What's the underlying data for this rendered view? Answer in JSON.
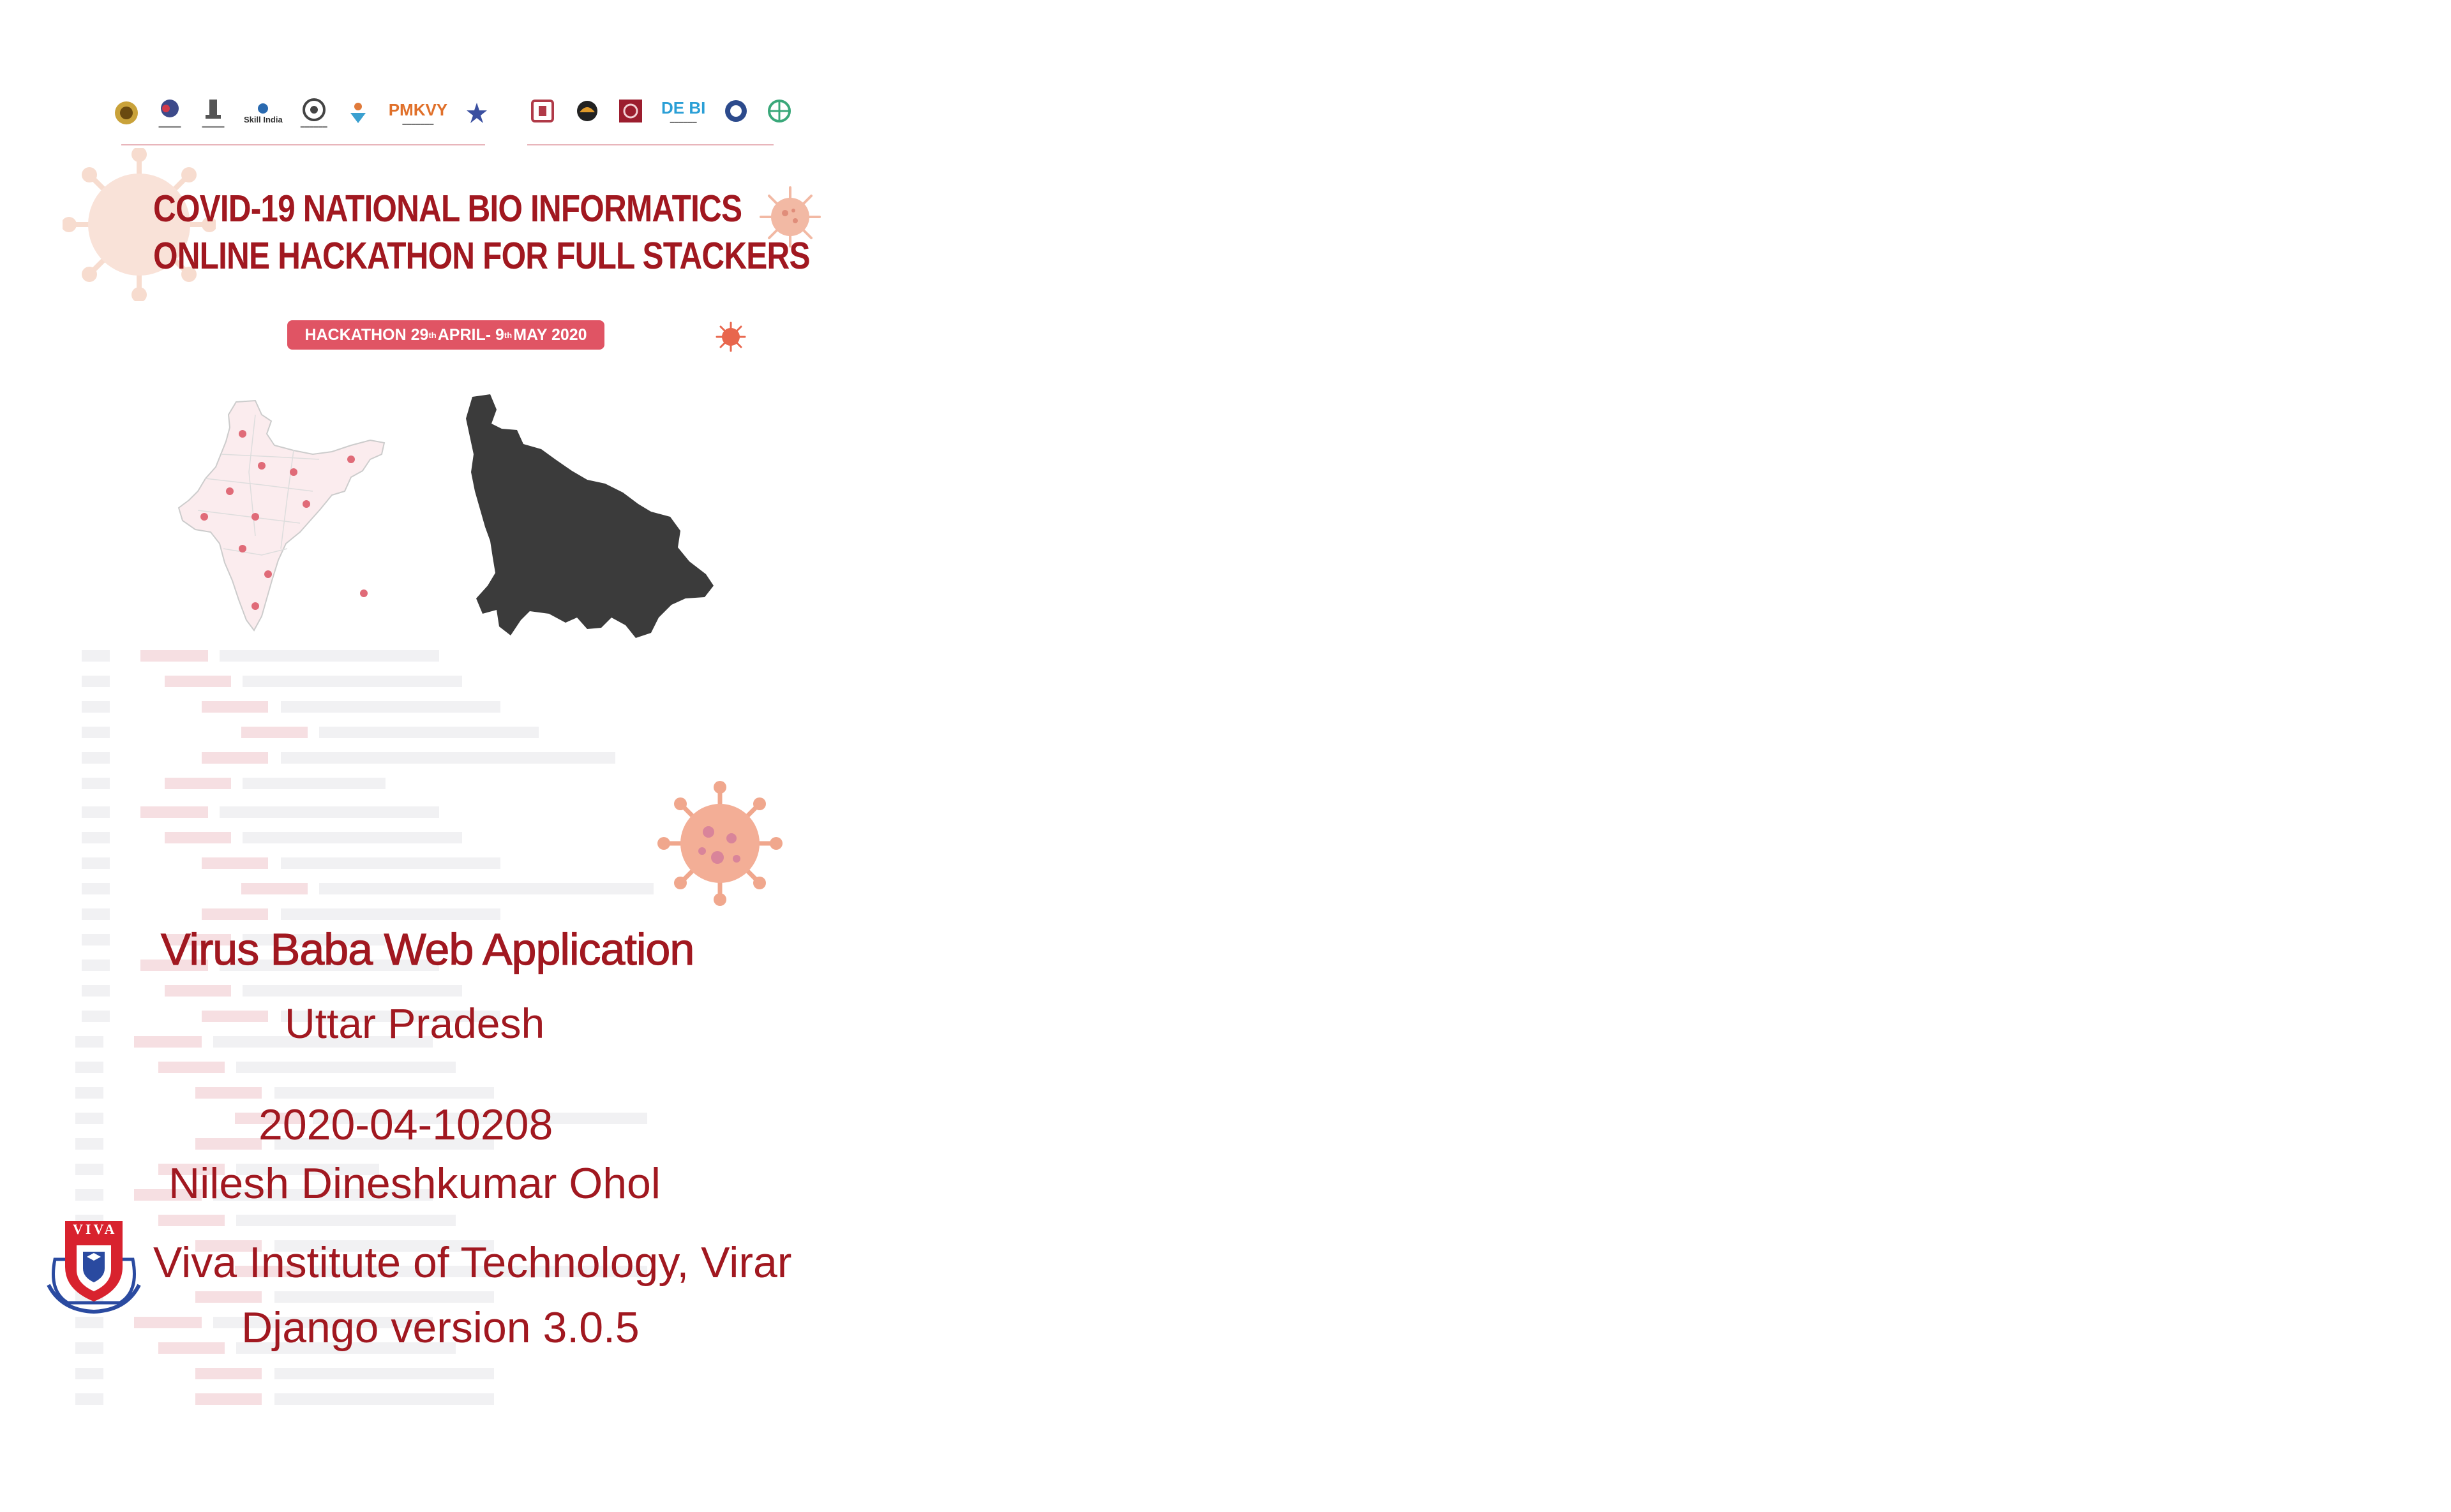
{
  "banner": {
    "logos_left": [
      {
        "icon": "emblem-seal-icon",
        "color": "#c9a23a"
      },
      {
        "icon": "ministry-logo-icon",
        "color": "#3d4a8a"
      },
      {
        "icon": "ashoka-emblem-icon",
        "color": "#555555"
      },
      {
        "icon": "skill-india-logo-icon",
        "word": "Skill India",
        "color": "#333333"
      },
      {
        "icon": "gear-circle-logo-icon",
        "color": "#444444"
      },
      {
        "icon": "person-figure-logo-icon",
        "color": "#e07a3a"
      },
      {
        "icon": "pmkvy-logo-icon",
        "word": "PMKVY",
        "color": "#e0702a"
      },
      {
        "icon": "star-figure-logo-icon",
        "color": "#3a4fa0"
      }
    ],
    "logos_right": [
      {
        "icon": "university-crest-icon",
        "color": "#b03a48"
      },
      {
        "icon": "swirl-logo-icon",
        "color": "#e09a2a"
      },
      {
        "icon": "square-seal-icon",
        "color": "#9c1d2e"
      },
      {
        "icon": "dexbi-logo-icon",
        "word": "DE BI",
        "color": "#2a9fd6"
      },
      {
        "icon": "round-seal-icon",
        "color": "#2c4a8c"
      },
      {
        "icon": "globe-logo-icon",
        "color": "#3aa87a"
      }
    ],
    "headline_line1": "COVID-19 NATIONAL BIO INFORMATICS",
    "headline_line2": "ONLINE HACKATHON FOR FULL STACKERS",
    "date_prefix": "HACKATHON  29",
    "date_sup1": "th",
    "date_middle": " APRIL- 9",
    "date_sup2": "th",
    "date_suffix": " MAY 2020"
  },
  "info": {
    "app_title": "Virus Baba Web Application",
    "state": "Uttar Pradesh",
    "registration_id": "2020-04-10208",
    "participant_name": "Nilesh Dineshkumar Ohol",
    "institute": "Viva Institute of Technology, Virar",
    "django_version": "Django version 3.0.5",
    "institute_logo_text": "VIVA"
  },
  "colors": {
    "accent": "#a11820",
    "pill": "#e05464",
    "map_fill": "#3b3b3b",
    "virus": "#eda892"
  }
}
